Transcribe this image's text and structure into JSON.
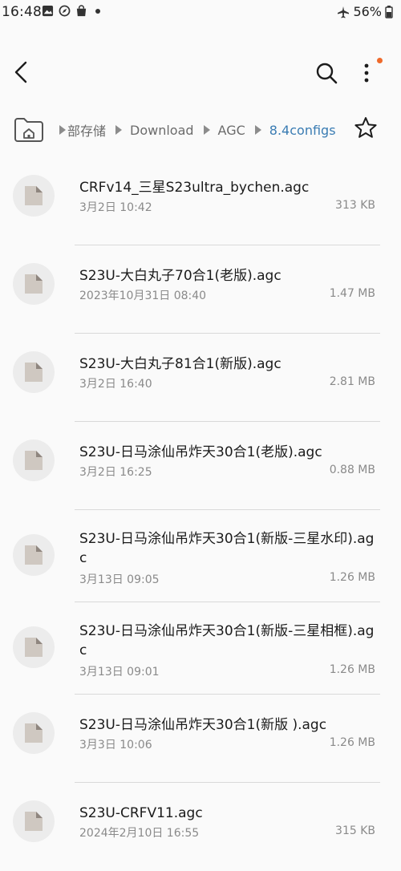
{
  "status": {
    "time": "16:48",
    "battery": "56%"
  },
  "breadcrumb": {
    "items": [
      "部存储",
      "Download",
      "AGC",
      "8.4configs"
    ]
  },
  "files": [
    {
      "name": "CRFv14_三星S23ultra_bychen.agc",
      "date": "3月2日 10:42",
      "size": "313 KB"
    },
    {
      "name": "S23U-大白丸子70合1(老版).agc",
      "date": "2023年10月31日 08:40",
      "size": "1.47 MB"
    },
    {
      "name": "S23U-大白丸子81合1(新版).agc",
      "date": "3月2日 16:40",
      "size": "2.81 MB"
    },
    {
      "name": "S23U-日马涂仙吊炸天30合1(老版).agc",
      "date": "3月2日 16:25",
      "size": "0.88 MB"
    },
    {
      "name": "S23U-日马涂仙吊炸天30合1(新版-三星水印).agc",
      "date": "3月13日 09:05",
      "size": "1.26 MB"
    },
    {
      "name": "S23U-日马涂仙吊炸天30合1(新版-三星相框).agc",
      "date": "3月13日 09:01",
      "size": "1.26 MB"
    },
    {
      "name": "S23U-日马涂仙吊炸天30合1(新版 ).agc",
      "date": "3月3日 10:06",
      "size": "1.26 MB"
    },
    {
      "name": "S23U-CRFV11.agc",
      "date": "2024年2月10日 16:55",
      "size": "315 KB"
    }
  ],
  "icons": {
    "back": "back-arrow-icon",
    "search": "search-icon",
    "more": "more-vert-icon",
    "home": "home-folder-icon",
    "star": "star-icon",
    "file": "document-icon"
  },
  "colors": {
    "accent": "#3a7cb3",
    "badge": "#ef6a2b"
  }
}
